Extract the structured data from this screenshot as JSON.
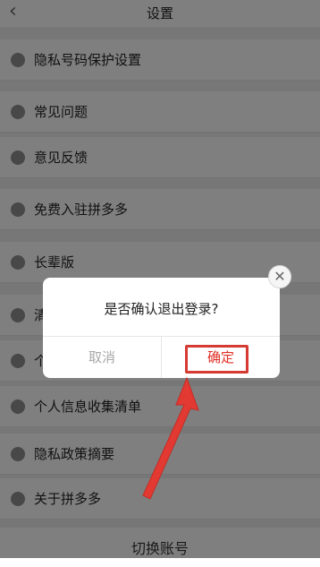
{
  "header": {
    "back_icon": "back-chevron-icon",
    "title": "设置"
  },
  "menu": [
    {
      "label": "隐私号码保护设置",
      "icon": "privacy-phone-icon"
    },
    {
      "label": "常见问题",
      "icon": "faq-icon"
    },
    {
      "label": "意见反馈",
      "icon": "feedback-icon"
    },
    {
      "label": "免费入驻拼多多",
      "icon": "store-icon"
    },
    {
      "label": "长辈版",
      "icon": "elder-mode-icon"
    },
    {
      "label": "清",
      "icon": "clear-cache-icon"
    },
    {
      "label": "个",
      "icon": "personal-icon"
    },
    {
      "label": "个人信息收集清单",
      "icon": "info-list-icon"
    },
    {
      "label": "隐私政策摘要",
      "icon": "privacy-policy-icon"
    },
    {
      "label": "关于拼多多",
      "icon": "about-icon"
    }
  ],
  "switch_account": "切换账号",
  "dialog": {
    "message": "是否确认退出登录?",
    "cancel": "取消",
    "confirm": "确定",
    "close_icon": "close-icon"
  },
  "colors": {
    "accent": "#e02e24",
    "annotation": "#d53a33"
  }
}
